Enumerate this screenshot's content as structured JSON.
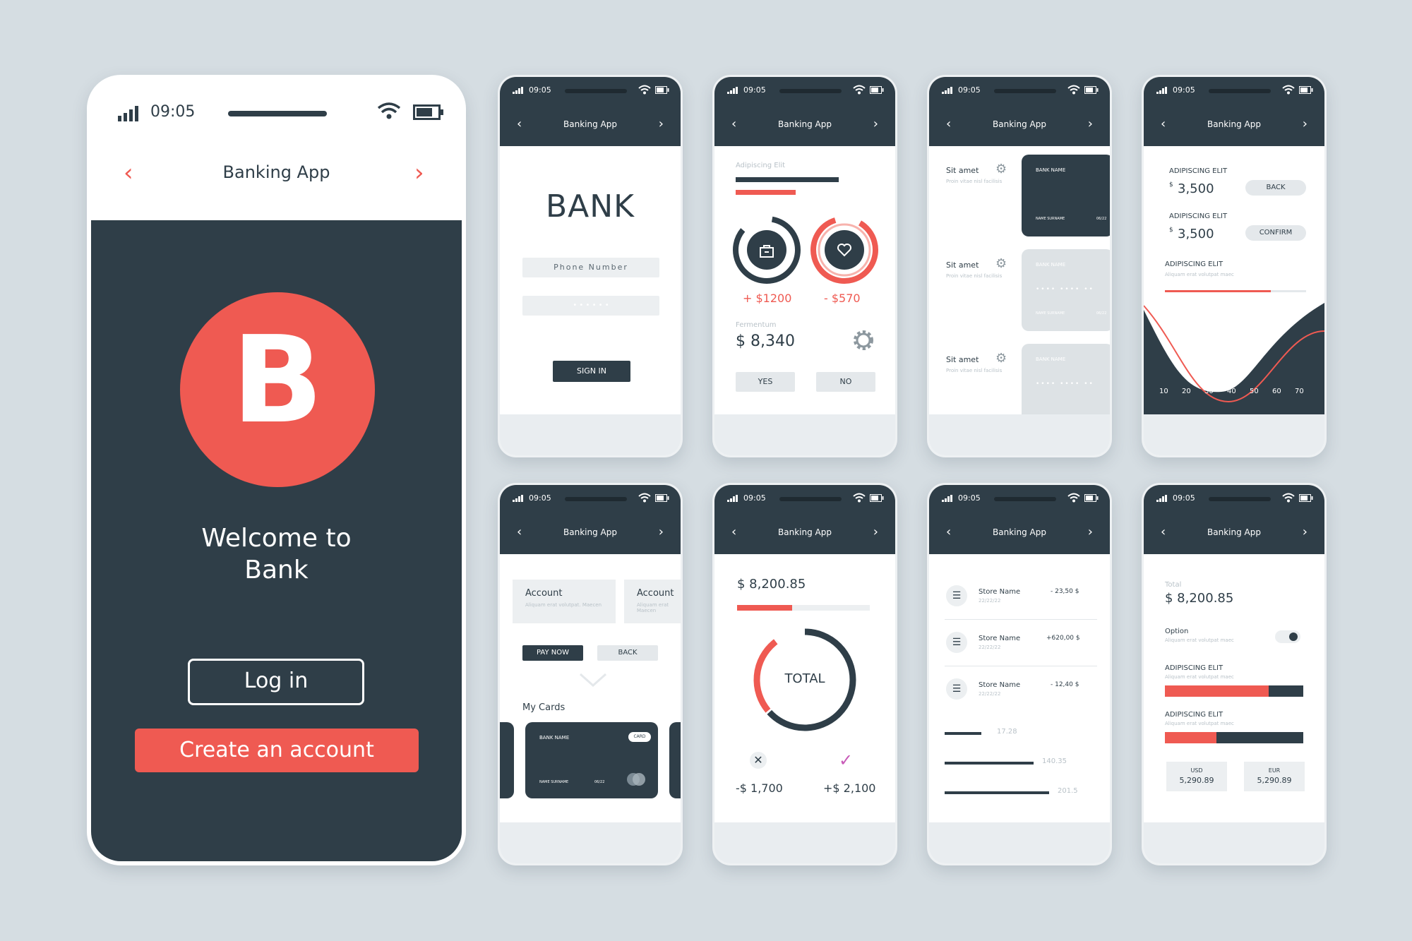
{
  "main_phone": {
    "time": "09:05",
    "title": "Banking App",
    "logo_letter": "B",
    "welcome_line1": "Welcome to",
    "welcome_line2": "Bank",
    "login_label": "Log in",
    "create_label": "Create an account"
  },
  "common": {
    "time": "09:05",
    "title": "Banking App"
  },
  "login_screen": {
    "brand": "BANK",
    "phone_placeholder": "Phone Number",
    "password_mask": "• • • • • •",
    "signin_label": "SIGN IN"
  },
  "stats_screen": {
    "label": "Adipiscing Elit",
    "income": "+ $1200",
    "expense": "- $570",
    "section_label": "Fermentum",
    "amount": "$ 8,340",
    "yes_label": "YES",
    "no_label": "NO"
  },
  "cards_screen": {
    "rows": [
      {
        "title": "Sit amet",
        "sub": "Proin vitae nisl facilisis"
      },
      {
        "title": "Sit amet",
        "sub": "Proin vitae nisl facilisis"
      },
      {
        "title": "Sit amet",
        "sub": "Proin vitae nisl facilisis"
      }
    ],
    "card_bank": "BANK NAME",
    "card_holder": "NAME SURNAME",
    "card_exp": "06/22",
    "card_dots": "••••  ••••  ••"
  },
  "chart_screen": {
    "label1": "ADIPISCING ELIT",
    "amount1": "3,500",
    "back_label": "BACK",
    "label2": "ADIPISCING ELIT",
    "amount2": "3,500",
    "confirm_label": "CONFIRM",
    "label3": "ADIPISCING ELIT",
    "sub3": "Aliquam erat volutpat maec"
  },
  "chart_data": {
    "type": "area",
    "x": [
      10,
      20,
      30,
      40,
      50,
      60,
      70
    ],
    "xticks": [
      "10",
      "20",
      "30",
      "40",
      "50",
      "60",
      "70"
    ],
    "colors": {
      "area": "#2f3e48",
      "line": "#ef5a52"
    }
  },
  "accounts_screen": {
    "accounts": [
      {
        "title": "Account",
        "sub": "Aliquam erat volutpat. Maecen"
      },
      {
        "title": "Account",
        "sub": "Aliquam erat Maecen"
      }
    ],
    "pay_label": "PAY NOW",
    "back_label": "BACK",
    "my_cards_label": "My Cards",
    "card_bank": "BANK NAME",
    "card_tag": "CARD",
    "card_holder": "NAME SURNAME",
    "card_exp": "06/22"
  },
  "total_screen": {
    "amount": "$ 8,200.85",
    "total_label": "TOTAL",
    "minus": "-$ 1,700",
    "plus": "+$ 2,100"
  },
  "transactions_screen": {
    "items": [
      {
        "store": "Store Name",
        "date": "22/22/22",
        "amount": "- 23,50 $"
      },
      {
        "store": "Store Name",
        "date": "22/22/22",
        "amount": "+620,00 $"
      },
      {
        "store": "Store Name",
        "date": "22/22/22",
        "amount": "- 12,40 $"
      }
    ],
    "bars": [
      {
        "value": "17.28",
        "fraction": 0.2
      },
      {
        "value": "140.35",
        "fraction": 0.65
      },
      {
        "value": "201.5",
        "fraction": 0.76
      }
    ]
  },
  "settings_screen": {
    "total_label": "Total",
    "amount": "$ 8,200.85",
    "option_label": "Option",
    "option_sub": "Aliquam erat volutpat maec",
    "section1": "ADIPISCING ELIT",
    "section1_sub": "Aliquam erat volutpat maec",
    "section1_fill": 0.75,
    "section2": "ADIPISCING ELIT",
    "section2_sub": "Aliquam erat volutpat maec",
    "section2_fill": 0.37,
    "usd_label": "USD",
    "usd_value": "5,290.89",
    "eur_label": "EUR",
    "eur_value": "5,290.89"
  },
  "colors": {
    "primary": "#2f3e48",
    "accent": "#ef5a52",
    "background": "#d5dde2"
  }
}
